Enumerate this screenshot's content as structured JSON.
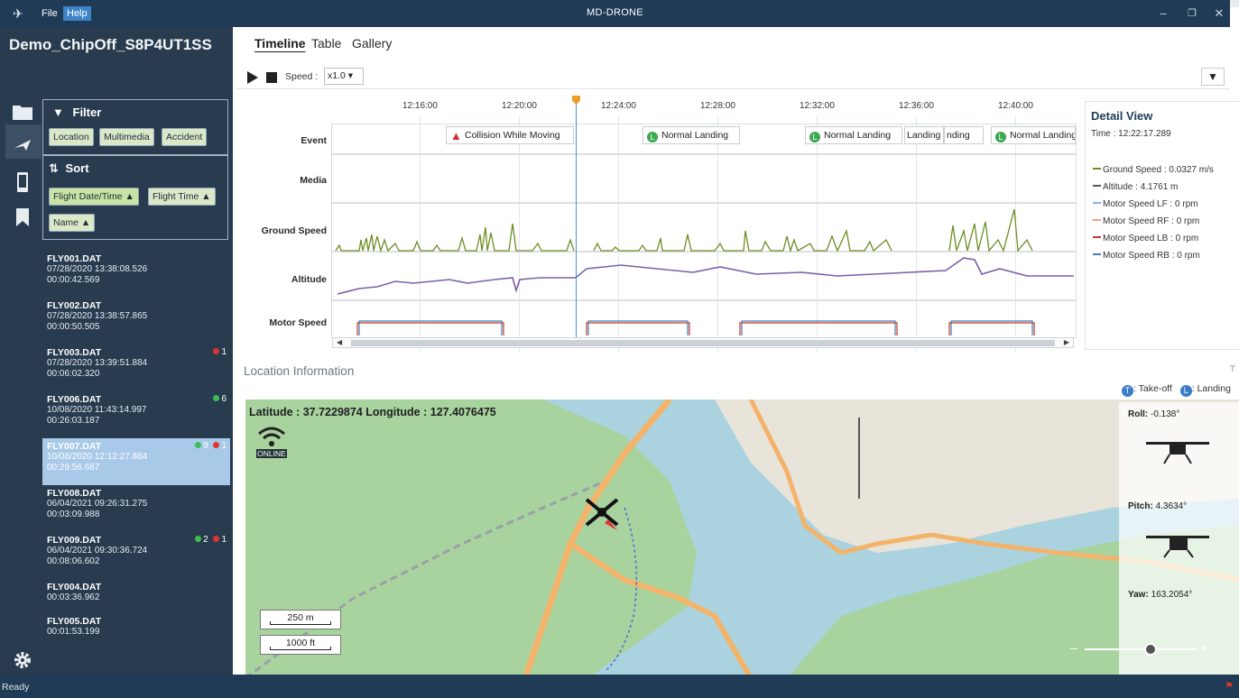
{
  "titlebar": {
    "file_menu": "File",
    "help_menu": "Help",
    "title": "MD-DRONE",
    "minimize": "–",
    "restore": "❐",
    "close": "✕"
  },
  "project": {
    "name": "Demo_ChipOff_S8P4UT1SS"
  },
  "filter": {
    "title": "Filter",
    "chips": [
      "Location",
      "Multimedia",
      "Accident"
    ]
  },
  "sort": {
    "title": "Sort",
    "chips": [
      "Flight Date/Time ▲",
      "Flight Time ▲",
      "Name ▲"
    ]
  },
  "files": [
    {
      "name": "FLY001.DAT",
      "date": "07/28/2020 13:38:08.526",
      "duration": "00:00:42.569",
      "green": "",
      "red": ""
    },
    {
      "name": "FLY002.DAT",
      "date": "07/28/2020 13:38:57.865",
      "duration": "00:00:50.505",
      "green": "",
      "red": ""
    },
    {
      "name": "FLY003.DAT",
      "date": "07/28/2020 13:39:51.884",
      "duration": "00:06:02.320",
      "green": "",
      "red": "1"
    },
    {
      "name": "FLY006.DAT",
      "date": "10/08/2020 11:43:14.997",
      "duration": "00:26:03.187",
      "green": "6",
      "red": ""
    },
    {
      "name": "FLY007.DAT",
      "date": "10/08/2020 12:12:27.884",
      "duration": "00:29:56.687",
      "green": "9",
      "red": "1"
    },
    {
      "name": "FLY008.DAT",
      "date": "06/04/2021 09:26:31.275",
      "duration": "00:03:09.988",
      "green": "",
      "red": ""
    },
    {
      "name": "FLY009.DAT",
      "date": "06/04/2021 09:30:36.724",
      "duration": "00:08:06.602",
      "green": "2",
      "red": "1"
    },
    {
      "name": "FLY004.DAT",
      "date": "",
      "duration": "00:03:36.962",
      "green": "",
      "red": ""
    },
    {
      "name": "FLY005.DAT",
      "date": "",
      "duration": "00:01:53.199",
      "green": "",
      "red": ""
    }
  ],
  "tabs": [
    "Timeline",
    "Table",
    "Gallery"
  ],
  "toolbar": {
    "speed_label": "Speed :",
    "speed_value": "x1.0 ▾"
  },
  "timeline": {
    "ticks": [
      "12:16:00",
      "12:20:00",
      "12:24:00",
      "12:28:00",
      "12:32:00",
      "12:36:00",
      "12:40:00"
    ],
    "rows": [
      "Event",
      "Media",
      "Ground Speed",
      "Altitude",
      "Motor Speed"
    ],
    "events": [
      "Collision While Moving",
      "Normal Landing",
      "Normal Landing",
      "Landing",
      "nding",
      "Normal Landing"
    ],
    "playhead_time": "12:22:17.289"
  },
  "detail": {
    "title": "Detail View",
    "time": "Time : 12:22:17.289",
    "items": [
      {
        "label": "Ground Speed : 0.0327 m/s",
        "color": "#6b8e23"
      },
      {
        "label": "Altitude : 4.1761 m",
        "color": "#5a5a5a"
      },
      {
        "label": "Motor Speed LF : 0 rpm",
        "color": "#7fb3e6"
      },
      {
        "label": "Motor Speed RF : 0 rpm",
        "color": "#f0a080"
      },
      {
        "label": "Motor Speed LB : 0 rpm",
        "color": "#c0392b"
      },
      {
        "label": "Motor Speed RB : 0 rpm",
        "color": "#4a78b0"
      }
    ]
  },
  "location": {
    "title": "Location Information",
    "legend_takeoff": ": Take-off",
    "legend_landing": ": Landing",
    "coords": "Latitude : 37.7229874  Longitude : 127.4076475",
    "online": "ONLINE",
    "scale_m": "250 m",
    "scale_ft": "1000 ft",
    "roll_label": "Roll:",
    "roll_value": "-0.138°",
    "pitch_label": "Pitch:",
    "pitch_value": "4.3634°",
    "yaw_label": "Yaw:",
    "yaw_value": "163.2054°",
    "zoom_minus": "–",
    "zoom_plus": "+"
  },
  "status": {
    "text": "Ready"
  }
}
